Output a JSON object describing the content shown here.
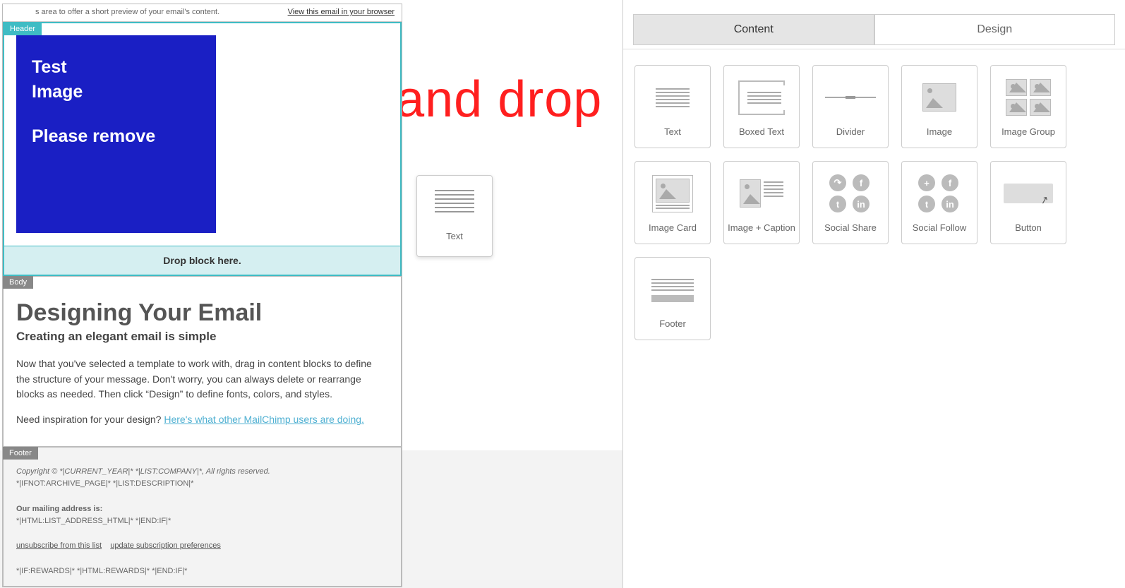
{
  "annotation": {
    "drag_label": "Drag and drop"
  },
  "preview": {
    "text": "s area to offer a short preview of your email's content.",
    "link": "View this email in your browser"
  },
  "sections": {
    "header_tag": "Header",
    "body_tag": "Body",
    "footer_tag": "Footer"
  },
  "header": {
    "image_text_1": "Test",
    "image_text_2": "Image",
    "image_text_3": "Please remove",
    "drop_text": "Drop block here."
  },
  "body": {
    "h1": "Designing Your Email",
    "h3": "Creating an elegant email is simple",
    "p1": "Now that you've selected a template to work with, drag in content blocks to define the structure of your message. Don't worry, you can always delete or rearrange blocks as needed. Then click “Design” to define fonts, colors, and styles.",
    "p2_prefix": "Need inspiration for your design? ",
    "p2_link": "Here's what other MailChimp users are doing."
  },
  "footer": {
    "line1": "Copyright © *|CURRENT_YEAR|* *|LIST:COMPANY|*, All rights reserved.",
    "line2": "*|IFNOT:ARCHIVE_PAGE|* *|LIST:DESCRIPTION|*",
    "mailing_label": "Our mailing address is:",
    "mailing_value": "*|HTML:LIST_ADDRESS_HTML|* *|END:IF|*",
    "unsubscribe": "unsubscribe from this list",
    "update_prefs": "update subscription preferences",
    "rewards": "*|IF:REWARDS|* *|HTML:REWARDS|* *|END:IF|*"
  },
  "ghost": {
    "label": "Text"
  },
  "panel": {
    "tab_content": "Content",
    "tab_design": "Design",
    "blocks": {
      "text": "Text",
      "boxed_text": "Boxed Text",
      "divider": "Divider",
      "image": "Image",
      "image_group": "Image Group",
      "image_card": "Image Card",
      "image_caption": "Image + Caption",
      "social_share": "Social Share",
      "social_follow": "Social Follow",
      "button": "Button",
      "footer": "Footer"
    }
  }
}
